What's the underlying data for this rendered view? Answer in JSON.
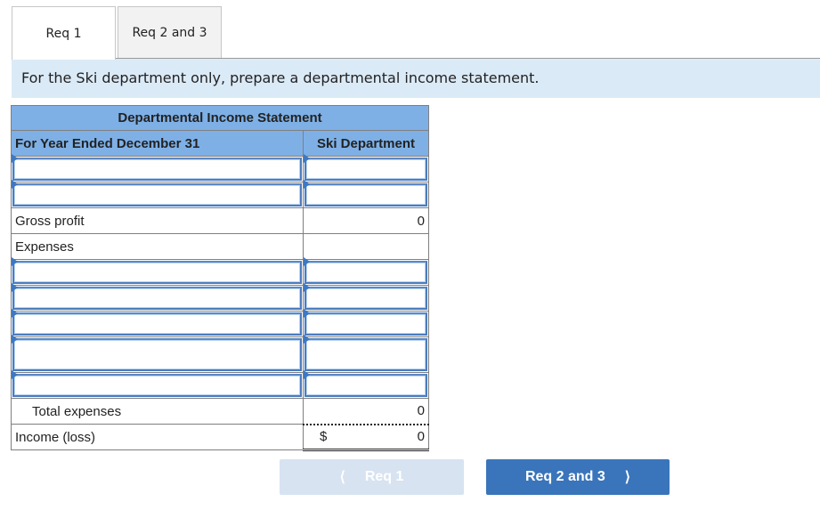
{
  "tabs": [
    {
      "label": "Req 1",
      "active": true
    },
    {
      "label": "Req 2 and 3",
      "active": false
    }
  ],
  "instructions": "For the Ski department only, prepare a departmental income statement.",
  "statement": {
    "title": "Departmental Income Statement",
    "period_label": "For Year Ended December 31",
    "column_header": "Ski Department",
    "revenue_inputs": [
      {
        "label": "",
        "value": ""
      },
      {
        "label": "",
        "value": ""
      }
    ],
    "gross_profit": {
      "label": "Gross profit",
      "value": "0"
    },
    "expenses_label": "Expenses",
    "expense_inputs": [
      {
        "label": "",
        "value": ""
      },
      {
        "label": "",
        "value": ""
      },
      {
        "label": "",
        "value": ""
      },
      {
        "label": "",
        "value": ""
      },
      {
        "label": "",
        "value": ""
      }
    ],
    "total_expenses": {
      "label": "Total expenses",
      "value": "0"
    },
    "income": {
      "label": "Income (loss)",
      "currency": "$",
      "value": "0"
    }
  },
  "nav": {
    "prev_label": "Req 1",
    "prev_icon": "chevron-left-icon",
    "next_label": "Req 2 and 3",
    "next_icon": "chevron-right-icon"
  },
  "colors": {
    "header_bg": "#7eb0e6",
    "instructions_bg": "#dbeaf7",
    "next_button": "#3a75bb",
    "prev_button_disabled": "#d7e3f1"
  }
}
